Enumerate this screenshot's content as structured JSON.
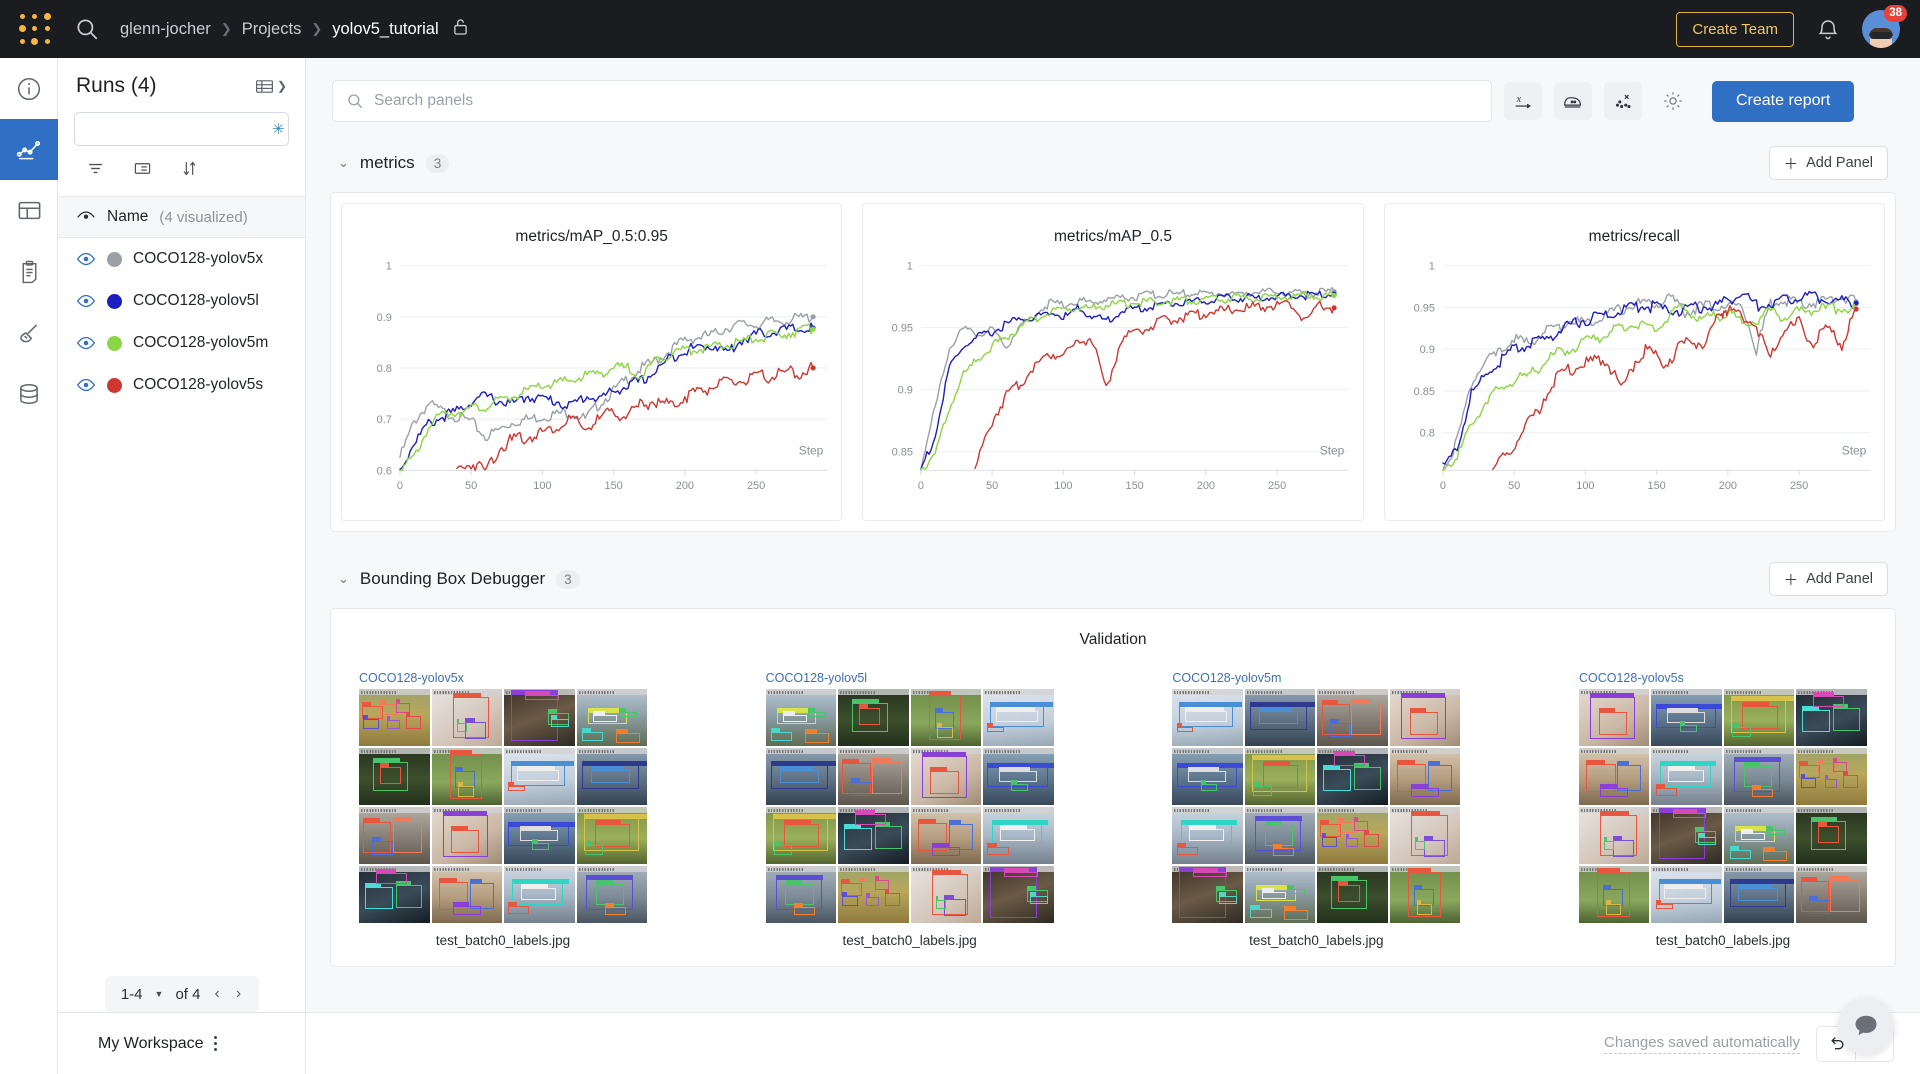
{
  "topbar": {
    "logo_icon": "wandb-dots-logo",
    "search_icon": "search-icon",
    "breadcrumb": {
      "entity": "glenn-jocher",
      "section": "Projects",
      "project": "yolov5_tutorial",
      "lock_icon": "unlocked-padlock-icon"
    },
    "create_team_label": "Create Team",
    "bell_icon": "notification-bell-icon",
    "notification_count": "38",
    "avatar_icon": "user-avatar"
  },
  "rail": {
    "items": [
      {
        "name": "overview",
        "icon": "info-circle-icon",
        "active": false
      },
      {
        "name": "workspace",
        "icon": "line-chart-icon",
        "active": true
      },
      {
        "name": "table",
        "icon": "table-icon",
        "active": false
      },
      {
        "name": "reports",
        "icon": "clipboard-icon",
        "active": false
      },
      {
        "name": "sweeps",
        "icon": "broom-icon",
        "active": false
      },
      {
        "name": "artifacts",
        "icon": "database-icon",
        "active": false
      }
    ]
  },
  "sidebar": {
    "title": "Runs (4)",
    "table_icon": "runs-table-icon",
    "search": {
      "value": "",
      "placeholder": "",
      "icon": "search-icon",
      "magic_icon": "magic-sparkle-icon"
    },
    "tools": [
      {
        "name": "filter",
        "icon": "filter-icon"
      },
      {
        "name": "columns",
        "icon": "list-columns-icon"
      },
      {
        "name": "sort",
        "icon": "sort-icon"
      }
    ],
    "group_header": {
      "eye_icon": "eye-closed-icon",
      "label": "Name",
      "count": "(4 visualized)"
    },
    "runs": [
      {
        "name": "COCO128-yolov5x",
        "color": "#9aa0a6",
        "eye_icon": "eye-icon"
      },
      {
        "name": "COCO128-yolov5l",
        "color": "#1b1ec0",
        "eye_icon": "eye-icon"
      },
      {
        "name": "COCO128-yolov5m",
        "color": "#8bd642",
        "eye_icon": "eye-icon"
      },
      {
        "name": "COCO128-yolov5s",
        "color": "#cf3630",
        "eye_icon": "eye-icon"
      }
    ],
    "pager": {
      "range": "1-4",
      "of": "of 4",
      "prev_icon": "chevron-left-icon",
      "next_icon": "chevron-right-icon",
      "caret_icon": "caret-down-icon"
    },
    "workspace": {
      "label": "My Workspace",
      "menu_icon": "kebab-menu-icon"
    }
  },
  "toolbar": {
    "search": {
      "value": "",
      "placeholder": "Search panels",
      "icon": "search-icon"
    },
    "buttons": [
      {
        "name": "x-axis",
        "icon": "x-axis-icon"
      },
      {
        "name": "smoothing",
        "icon": "iron-smoothing-icon"
      },
      {
        "name": "outliers",
        "icon": "scatter-outliers-icon"
      },
      {
        "name": "settings",
        "icon": "gear-icon"
      }
    ],
    "create_report_label": "Create report"
  },
  "sections": [
    {
      "name": "metrics",
      "count": "3",
      "add_panel_label": "Add Panel",
      "chevron_icon": "chevron-down-icon",
      "plus_icon": "plus-icon"
    },
    {
      "name": "Bounding Box Debugger",
      "count": "3",
      "add_panel_label": "Add Panel",
      "chevron_icon": "chevron-down-icon",
      "plus_icon": "plus-icon"
    }
  ],
  "bbox_panel": {
    "title": "Validation",
    "groups": [
      {
        "label": "COCO128-yolov5x",
        "caption": "test_batch0_labels.jpg"
      },
      {
        "label": "COCO128-yolov5l",
        "caption": "test_batch0_labels.jpg"
      },
      {
        "label": "COCO128-yolov5m",
        "caption": "test_batch0_labels.jpg"
      },
      {
        "label": "COCO128-yolov5s",
        "caption": "test_batch0_labels.jpg"
      }
    ]
  },
  "bottombar": {
    "saved_label": "Changes saved automatically",
    "undo_icon": "undo-arrow-icon",
    "redo_icon": "redo-arrow-icon",
    "chat_icon": "chat-bubble-icon"
  },
  "chart_data": [
    {
      "type": "line",
      "title": "metrics/mAP_0.5:0.95",
      "xlabel": "Step",
      "ylabel": "",
      "xlim": [
        0,
        300
      ],
      "ylim": [
        0.6,
        1.0
      ],
      "xticks": [
        0,
        50,
        100,
        150,
        200,
        250
      ],
      "yticks": [
        0.6,
        0.7,
        0.8,
        0.9,
        1
      ],
      "ytick_labels": [
        "0.6",
        "0.7",
        "0.8",
        "0.9",
        "1"
      ],
      "grid": true,
      "legend": "none",
      "series": [
        {
          "name": "COCO128-yolov5x",
          "color": "#9aa0a6",
          "x": [
            0,
            10,
            20,
            30,
            40,
            50,
            60,
            70,
            80,
            90,
            100,
            110,
            120,
            130,
            140,
            150,
            160,
            170,
            180,
            190,
            200,
            210,
            220,
            230,
            240,
            250,
            260,
            270,
            280,
            290
          ],
          "y": [
            0.625,
            0.695,
            0.73,
            0.715,
            0.705,
            0.695,
            0.665,
            0.68,
            0.695,
            0.7,
            0.705,
            0.71,
            0.715,
            0.7,
            0.73,
            0.755,
            0.78,
            0.8,
            0.815,
            0.835,
            0.855,
            0.86,
            0.865,
            0.88,
            0.885,
            0.885,
            0.89,
            0.893,
            0.897,
            0.9
          ]
        },
        {
          "name": "COCO128-yolov5l",
          "color": "#1b1ec0",
          "x": [
            0,
            10,
            20,
            30,
            40,
            50,
            60,
            70,
            80,
            90,
            100,
            110,
            120,
            130,
            140,
            150,
            160,
            170,
            180,
            190,
            200,
            210,
            220,
            230,
            240,
            250,
            260,
            270,
            280,
            290
          ],
          "y": [
            0.6,
            0.655,
            0.69,
            0.705,
            0.715,
            0.735,
            0.745,
            0.735,
            0.73,
            0.745,
            0.74,
            0.735,
            0.725,
            0.745,
            0.74,
            0.755,
            0.765,
            0.775,
            0.795,
            0.82,
            0.835,
            0.84,
            0.845,
            0.83,
            0.855,
            0.865,
            0.87,
            0.875,
            0.875,
            0.878
          ]
        },
        {
          "name": "COCO128-yolov5m",
          "color": "#8bd642",
          "x": [
            0,
            10,
            20,
            30,
            40,
            50,
            60,
            70,
            80,
            90,
            100,
            110,
            120,
            130,
            140,
            150,
            160,
            170,
            180,
            190,
            200,
            210,
            220,
            230,
            240,
            250,
            260,
            270,
            280,
            290
          ],
          "y": [
            0.598,
            0.625,
            0.685,
            0.71,
            0.715,
            0.72,
            0.725,
            0.735,
            0.745,
            0.755,
            0.765,
            0.77,
            0.775,
            0.785,
            0.79,
            0.8,
            0.8,
            0.785,
            0.815,
            0.83,
            0.835,
            0.838,
            0.84,
            0.845,
            0.85,
            0.858,
            0.862,
            0.868,
            0.873,
            0.876
          ]
        },
        {
          "name": "COCO128-yolov5s",
          "color": "#cf3630",
          "x": [
            40,
            50,
            60,
            70,
            80,
            90,
            100,
            110,
            120,
            130,
            140,
            150,
            160,
            170,
            180,
            190,
            200,
            210,
            220,
            230,
            240,
            250,
            260,
            270,
            280,
            290
          ],
          "y": [
            0.6,
            0.615,
            0.6,
            0.645,
            0.66,
            0.665,
            0.675,
            0.685,
            0.7,
            0.68,
            0.7,
            0.715,
            0.705,
            0.73,
            0.735,
            0.725,
            0.745,
            0.755,
            0.765,
            0.77,
            0.775,
            0.78,
            0.785,
            0.79,
            0.79,
            0.8
          ]
        }
      ]
    },
    {
      "type": "line",
      "title": "metrics/mAP_0.5",
      "xlabel": "Step",
      "ylabel": "",
      "xlim": [
        0,
        300
      ],
      "ylim": [
        0.835,
        1.0
      ],
      "xticks": [
        0,
        50,
        100,
        150,
        200,
        250
      ],
      "yticks": [
        0.85,
        0.9,
        0.95,
        1
      ],
      "ytick_labels": [
        "0.85",
        "0.9",
        "0.95",
        "1"
      ],
      "grid": true,
      "legend": "none",
      "series": [
        {
          "name": "COCO128-yolov5x",
          "color": "#9aa0a6",
          "x": [
            0,
            10,
            20,
            30,
            40,
            50,
            60,
            70,
            80,
            90,
            100,
            110,
            120,
            130,
            140,
            150,
            160,
            170,
            180,
            190,
            200,
            210,
            220,
            230,
            240,
            250,
            260,
            270,
            280,
            290
          ],
          "y": [
            0.838,
            0.885,
            0.935,
            0.948,
            0.945,
            0.948,
            0.935,
            0.952,
            0.96,
            0.97,
            0.968,
            0.972,
            0.97,
            0.973,
            0.974,
            0.975,
            0.976,
            0.977,
            0.977,
            0.978,
            0.977,
            0.978,
            0.976,
            0.979,
            0.978,
            0.979,
            0.977,
            0.978,
            0.978,
            0.979
          ]
        },
        {
          "name": "COCO128-yolov5l",
          "color": "#1b1ec0",
          "x": [
            0,
            10,
            20,
            30,
            40,
            50,
            60,
            70,
            80,
            90,
            100,
            110,
            120,
            130,
            140,
            150,
            160,
            170,
            180,
            190,
            200,
            210,
            220,
            230,
            240,
            250,
            260,
            270,
            280,
            290
          ],
          "y": [
            0.836,
            0.862,
            0.918,
            0.935,
            0.942,
            0.946,
            0.953,
            0.957,
            0.958,
            0.963,
            0.958,
            0.965,
            0.96,
            0.955,
            0.963,
            0.965,
            0.967,
            0.969,
            0.97,
            0.971,
            0.972,
            0.973,
            0.974,
            0.974,
            0.974,
            0.975,
            0.976,
            0.976,
            0.977,
            0.977
          ]
        },
        {
          "name": "COCO128-yolov5m",
          "color": "#8bd642",
          "x": [
            0,
            10,
            20,
            30,
            40,
            50,
            60,
            70,
            80,
            90,
            100,
            110,
            120,
            130,
            140,
            150,
            160,
            170,
            180,
            190,
            200,
            210,
            220,
            230,
            240,
            250,
            260,
            270,
            280,
            290
          ],
          "y": [
            0.836,
            0.848,
            0.885,
            0.912,
            0.925,
            0.935,
            0.942,
            0.95,
            0.957,
            0.962,
            0.965,
            0.966,
            0.966,
            0.968,
            0.969,
            0.97,
            0.971,
            0.971,
            0.972,
            0.972,
            0.973,
            0.973,
            0.974,
            0.974,
            0.974,
            0.975,
            0.975,
            0.976,
            0.976,
            0.976
          ]
        },
        {
          "name": "COCO128-yolov5s",
          "color": "#cf3630",
          "x": [
            38,
            50,
            60,
            70,
            80,
            90,
            100,
            110,
            120,
            130,
            140,
            150,
            160,
            170,
            180,
            190,
            200,
            210,
            220,
            230,
            240,
            250,
            260,
            270,
            280,
            290
          ],
          "y": [
            0.836,
            0.875,
            0.895,
            0.905,
            0.92,
            0.928,
            0.93,
            0.938,
            0.942,
            0.9,
            0.938,
            0.948,
            0.95,
            0.955,
            0.958,
            0.96,
            0.962,
            0.963,
            0.965,
            0.966,
            0.967,
            0.968,
            0.968,
            0.956,
            0.968,
            0.966
          ]
        }
      ]
    },
    {
      "type": "line",
      "title": "metrics/recall",
      "xlabel": "Step",
      "ylabel": "",
      "xlim": [
        0,
        300
      ],
      "ylim": [
        0.755,
        1.0
      ],
      "xticks": [
        0,
        50,
        100,
        150,
        200,
        250
      ],
      "yticks": [
        0.8,
        0.85,
        0.9,
        0.95,
        1
      ],
      "ytick_labels": [
        "0.8",
        "0.85",
        "0.9",
        "0.95",
        "1"
      ],
      "grid": true,
      "legend": "none",
      "series": [
        {
          "name": "COCO128-yolov5x",
          "color": "#9aa0a6",
          "x": [
            0,
            10,
            20,
            30,
            40,
            50,
            60,
            70,
            80,
            90,
            100,
            110,
            120,
            130,
            140,
            150,
            160,
            170,
            180,
            190,
            200,
            210,
            220,
            230,
            240,
            250,
            260,
            270,
            280,
            290
          ],
          "y": [
            0.758,
            0.79,
            0.86,
            0.885,
            0.895,
            0.915,
            0.905,
            0.92,
            0.925,
            0.935,
            0.93,
            0.94,
            0.945,
            0.95,
            0.955,
            0.955,
            0.96,
            0.945,
            0.95,
            0.952,
            0.952,
            0.952,
            0.9,
            0.955,
            0.957,
            0.955,
            0.955,
            0.958,
            0.962,
            0.957
          ]
        },
        {
          "name": "COCO128-yolov5l",
          "color": "#1b1ec0",
          "x": [
            0,
            10,
            20,
            30,
            40,
            50,
            60,
            70,
            80,
            90,
            100,
            110,
            120,
            130,
            140,
            150,
            160,
            170,
            180,
            190,
            200,
            210,
            220,
            230,
            240,
            250,
            260,
            270,
            280,
            290
          ],
          "y": [
            0.757,
            0.782,
            0.845,
            0.87,
            0.885,
            0.9,
            0.905,
            0.91,
            0.92,
            0.93,
            0.935,
            0.94,
            0.942,
            0.95,
            0.952,
            0.95,
            0.945,
            0.948,
            0.95,
            0.952,
            0.958,
            0.968,
            0.952,
            0.955,
            0.958,
            0.965,
            0.963,
            0.96,
            0.958,
            0.955
          ]
        },
        {
          "name": "COCO128-yolov5m",
          "color": "#8bd642",
          "x": [
            0,
            10,
            20,
            30,
            40,
            50,
            60,
            70,
            80,
            90,
            100,
            110,
            120,
            130,
            140,
            150,
            160,
            170,
            180,
            190,
            200,
            210,
            220,
            230,
            240,
            250,
            260,
            270,
            280,
            290
          ],
          "y": [
            0.756,
            0.772,
            0.808,
            0.838,
            0.852,
            0.862,
            0.868,
            0.882,
            0.895,
            0.9,
            0.908,
            0.915,
            0.922,
            0.928,
            0.932,
            0.925,
            0.94,
            0.952,
            0.935,
            0.938,
            0.945,
            0.93,
            0.935,
            0.945,
            0.938,
            0.945,
            0.948,
            0.948,
            0.95,
            0.948
          ]
        },
        {
          "name": "COCO128-yolov5s",
          "color": "#cf3630",
          "x": [
            35,
            45,
            55,
            65,
            75,
            85,
            95,
            105,
            115,
            125,
            135,
            145,
            155,
            165,
            175,
            185,
            195,
            200,
            210,
            220,
            230,
            240,
            250,
            260,
            270,
            280,
            290
          ],
          "y": [
            0.758,
            0.77,
            0.8,
            0.822,
            0.855,
            0.872,
            0.878,
            0.885,
            0.89,
            0.848,
            0.888,
            0.9,
            0.878,
            0.902,
            0.91,
            0.905,
            0.945,
            0.948,
            0.938,
            0.93,
            0.888,
            0.925,
            0.93,
            0.905,
            0.925,
            0.905,
            0.948
          ]
        }
      ]
    }
  ]
}
